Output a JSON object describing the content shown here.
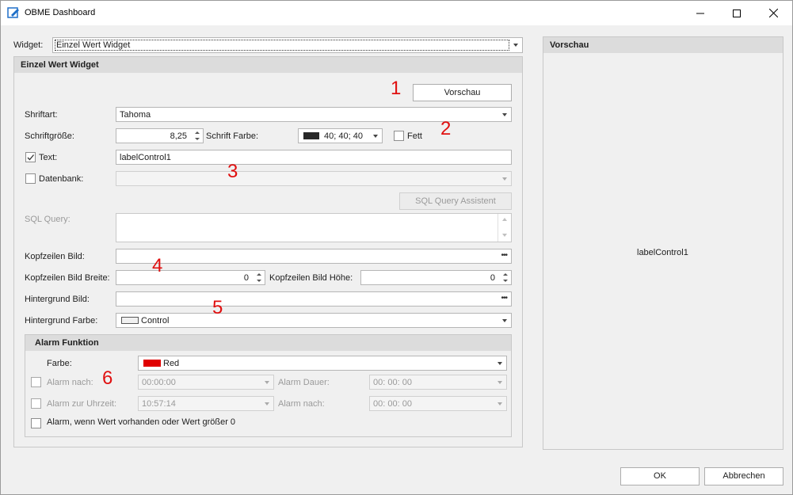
{
  "window": {
    "title": "OBME Dashboard"
  },
  "widget": {
    "label": "Widget:",
    "value": "Einzel Wert Widget"
  },
  "panel": {
    "title": "Einzel Wert Widget"
  },
  "preview_button": {
    "label": "Vorschau"
  },
  "font": {
    "label": "Shriftart:",
    "value": "Tahoma"
  },
  "font_size": {
    "label": "Schriftgröße:",
    "value": "8,25"
  },
  "font_color": {
    "label": "Schrift Farbe:",
    "value": "40; 40; 40",
    "color": "#282828"
  },
  "bold": {
    "label": "Fett"
  },
  "text": {
    "label": "Text:",
    "value": "labelControl1",
    "checked": true
  },
  "database": {
    "label": "Datenbank:"
  },
  "sql_assistant": {
    "label": "SQL Query Assistent"
  },
  "sql_query": {
    "label": "SQL Query:"
  },
  "header_image": {
    "label": "Kopfzeilen Bild:"
  },
  "header_width": {
    "label": "Kopfzeilen Bild Breite:",
    "value": "0"
  },
  "header_height": {
    "label": "Kopfzeilen Bild Höhe:",
    "value": "0"
  },
  "bg_image": {
    "label": "Hintergrund Bild:"
  },
  "bg_color": {
    "label": "Hintergrund Farbe:",
    "value": "Control",
    "color": "#f0f0f0"
  },
  "alarm": {
    "title": "Alarm Funktion",
    "color_label": "Farbe:",
    "color_value": "Red",
    "color": "#e00000",
    "after_label": "Alarm nach:",
    "after_value": "00:00:00",
    "duration_label": "Alarm Dauer:",
    "duration_value": "00: 00: 00",
    "time_label": "Alarm zur Uhrzeit:",
    "time_value": "10:57:14",
    "after2_label": "Alarm nach:",
    "after2_value": "00: 00: 00",
    "value_label": "Alarm, wenn Wert vorhanden oder Wert größer 0"
  },
  "preview": {
    "title": "Vorschau",
    "content": "labelControl1"
  },
  "ok_button": {
    "label": "OK"
  },
  "cancel_button": {
    "label": "Abbrechen"
  },
  "annotations": [
    "1",
    "2",
    "3",
    "4",
    "5",
    "6"
  ]
}
